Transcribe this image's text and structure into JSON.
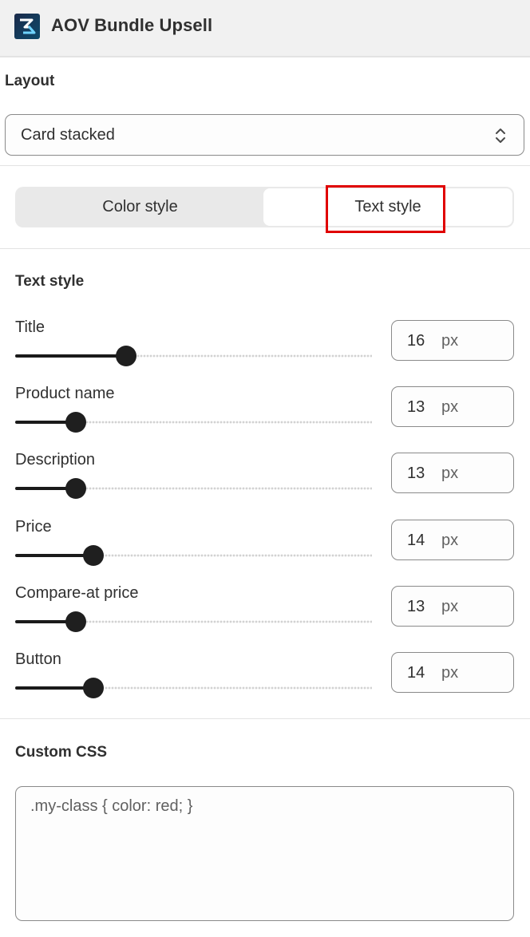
{
  "app": {
    "title": "AOV Bundle Upsell",
    "logo_icon": "app-logo-icon"
  },
  "layout": {
    "label": "Layout",
    "selected": "Card stacked",
    "chevron_icon": "chevron-up-down-icon"
  },
  "style_tabs": {
    "items": [
      "Color style",
      "Text style"
    ],
    "active": "Text style",
    "highlight_color": "#e00000"
  },
  "text_style": {
    "heading": "Text style",
    "unit": "px",
    "rows": [
      {
        "label": "Title",
        "value": "16",
        "level": 0.31
      },
      {
        "label": "Product name",
        "value": "13",
        "level": 0.17
      },
      {
        "label": "Description",
        "value": "13",
        "level": 0.17
      },
      {
        "label": "Price",
        "value": "14",
        "level": 0.22
      },
      {
        "label": "Compare-at price",
        "value": "13",
        "level": 0.17
      },
      {
        "label": "Button",
        "value": "14",
        "level": 0.22
      }
    ]
  },
  "custom_css": {
    "heading": "Custom CSS",
    "placeholder": ".my-class { color: red; }"
  }
}
